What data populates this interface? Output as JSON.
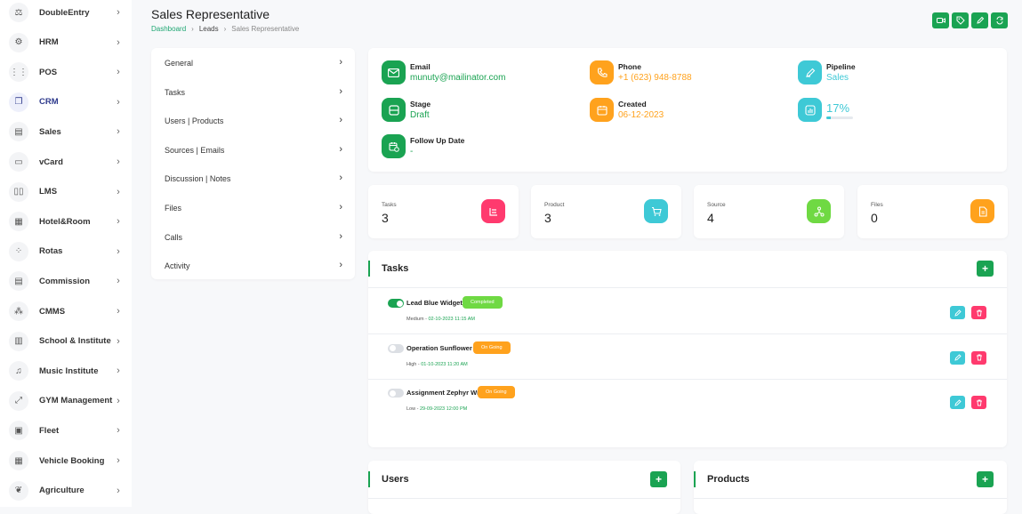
{
  "sidebar": {
    "items": [
      {
        "label": "DoubleEntry",
        "icon": "scale-icon",
        "glyph": "⚖"
      },
      {
        "label": "HRM",
        "icon": "users-icon",
        "glyph": "⚙"
      },
      {
        "label": "POS",
        "icon": "grid-icon",
        "glyph": "⋮⋮"
      },
      {
        "label": "CRM",
        "icon": "layers-icon",
        "glyph": "❐",
        "active": true
      },
      {
        "label": "Sales",
        "icon": "file-icon",
        "glyph": "▤"
      },
      {
        "label": "vCard",
        "icon": "card-icon",
        "glyph": "▭"
      },
      {
        "label": "LMS",
        "icon": "book-icon",
        "glyph": "▯▯"
      },
      {
        "label": "Hotel&Room",
        "icon": "building-icon",
        "glyph": "▦"
      },
      {
        "label": "Rotas",
        "icon": "apps-icon",
        "glyph": "⁘"
      },
      {
        "label": "Commission",
        "icon": "receipt-icon",
        "glyph": "▤"
      },
      {
        "label": "CMMS",
        "icon": "network-icon",
        "glyph": "⁂"
      },
      {
        "label": "School & Institute",
        "icon": "notebook-icon",
        "glyph": "▥"
      },
      {
        "label": "Music Institute",
        "icon": "music-icon",
        "glyph": "♫"
      },
      {
        "label": "GYM Management",
        "icon": "dumbbell-icon",
        "glyph": "⤢"
      },
      {
        "label": "Fleet",
        "icon": "bus-icon",
        "glyph": "▣"
      },
      {
        "label": "Vehicle Booking",
        "icon": "calendar-icon",
        "glyph": "▦"
      },
      {
        "label": "Agriculture",
        "icon": "plant-icon",
        "glyph": "❦"
      }
    ]
  },
  "header": {
    "title": "Sales Representative",
    "breadcrumb": [
      "Dashboard",
      "Leads",
      "Sales Representative"
    ]
  },
  "menu": [
    "General",
    "Tasks",
    "Users | Products",
    "Sources | Emails",
    "Discussion | Notes",
    "Files",
    "Calls",
    "Activity"
  ],
  "info": {
    "email": {
      "label": "Email",
      "value": "munuty@mailinator.com"
    },
    "phone": {
      "label": "Phone",
      "value": "+1 (623) 948-8788"
    },
    "pipeline": {
      "label": "Pipeline",
      "value": "Sales"
    },
    "stage": {
      "label": "Stage",
      "value": "Draft"
    },
    "created": {
      "label": "Created",
      "value": "06-12-2023"
    },
    "progress": {
      "value": "17%",
      "fraction": 0.17
    },
    "followup": {
      "label": "Follow Up Date",
      "value": "-"
    }
  },
  "stats": [
    {
      "label": "Tasks",
      "value": "3",
      "color": "#ff3a6e",
      "icon": "tasks-icon"
    },
    {
      "label": "Product",
      "value": "3",
      "color": "#3ec9d6",
      "icon": "cart-icon"
    },
    {
      "label": "Source",
      "value": "4",
      "color": "#6fd943",
      "icon": "share-icon"
    },
    {
      "label": "Files",
      "value": "0",
      "color": "#ffa21d",
      "icon": "file-icon"
    }
  ],
  "tasks": {
    "title": "Tasks",
    "items": [
      {
        "name": "Lead Blue Widget",
        "status": "Completed",
        "priority": "Medium",
        "date": "02-10-2023 11:15 AM",
        "done": true
      },
      {
        "name": "Operation Sunflower",
        "status": "On Going",
        "priority": "High",
        "date": "01-10-2023 11:20 AM",
        "done": false
      },
      {
        "name": "Assignment Zephyr Wind",
        "status": "On Going",
        "priority": "Low",
        "date": "29-09-2023 12:00 PM",
        "done": false
      }
    ]
  },
  "users": {
    "title": "Users"
  },
  "products": {
    "title": "Products"
  },
  "colors": {
    "green": "#1aa352",
    "orange": "#ffa21d",
    "teal": "#3ec9d6",
    "pink": "#ff3a6e",
    "lime": "#6fd943"
  }
}
